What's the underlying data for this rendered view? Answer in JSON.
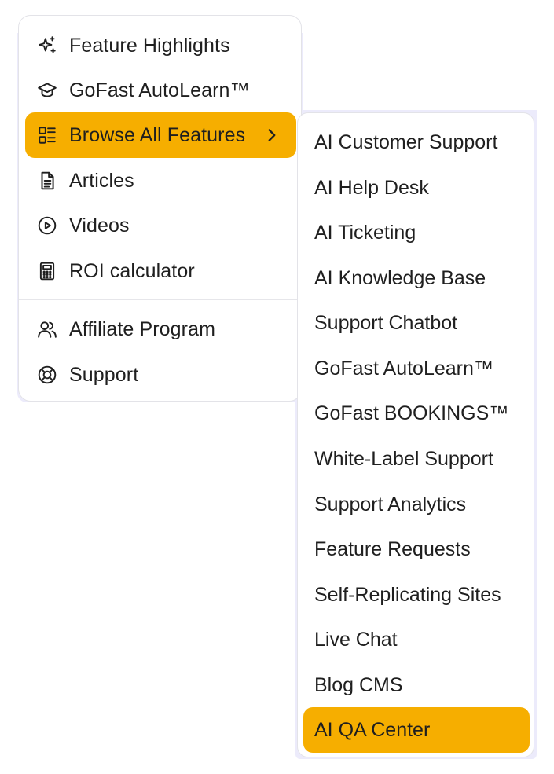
{
  "main_menu": {
    "items": [
      {
        "label": "Feature Highlights",
        "icon": "sparkles-icon"
      },
      {
        "label": "GoFast AutoLearn™",
        "icon": "graduation-cap-icon"
      },
      {
        "label": "Browse All Features",
        "icon": "list-grid-icon",
        "active": true
      },
      {
        "label": "Articles",
        "icon": "document-icon"
      },
      {
        "label": "Videos",
        "icon": "play-circle-icon"
      },
      {
        "label": "ROI calculator",
        "icon": "calculator-icon"
      }
    ],
    "secondary_items": [
      {
        "label": "Affiliate Program",
        "icon": "users-icon"
      },
      {
        "label": "Support",
        "icon": "lifebuoy-icon"
      }
    ]
  },
  "submenu": {
    "items": [
      "AI Customer Support",
      "AI Help Desk",
      "AI Ticketing",
      "AI Knowledge Base",
      "Support Chatbot",
      "GoFast AutoLearn™",
      "GoFast BOOKINGS™",
      "White-Label Support",
      "Support Analytics",
      "Feature Requests",
      "Self-Replicating Sites",
      "Live Chat",
      "Blog CMS",
      "AI QA Center"
    ],
    "active_item": "AI QA Center"
  },
  "colors": {
    "accent": "#f6ae00",
    "text": "#1f1f1f",
    "border": "#e3e3e8",
    "backdrop": "#ecebfb"
  }
}
